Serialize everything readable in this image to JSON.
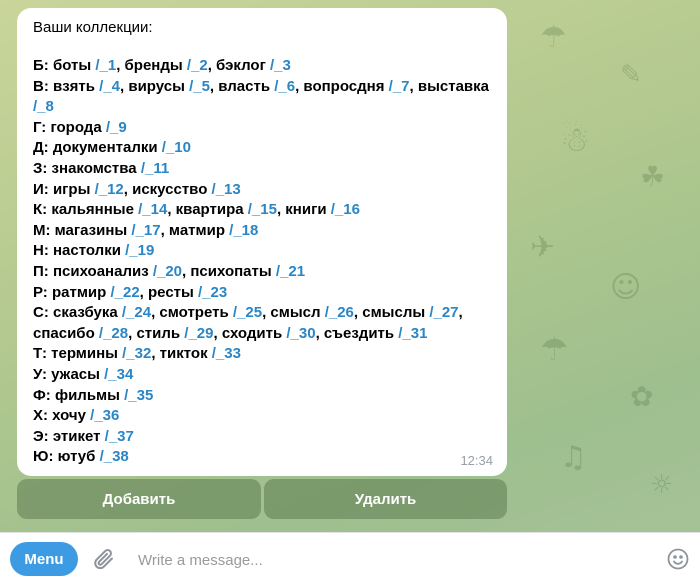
{
  "message": {
    "title": "Ваши коллекции:",
    "time": "12:34",
    "lines": [
      [
        {
          "t": "Б: боты "
        },
        {
          "c": "/_1"
        },
        {
          "t": ", бренды "
        },
        {
          "c": "/_2"
        },
        {
          "t": ", бэклог "
        },
        {
          "c": "/_3"
        }
      ],
      [
        {
          "t": "В: взять "
        },
        {
          "c": "/_4"
        },
        {
          "t": ", вирусы "
        },
        {
          "c": "/_5"
        },
        {
          "t": ", власть "
        },
        {
          "c": "/_6"
        },
        {
          "t": ", вопросдня "
        },
        {
          "c": "/_7"
        },
        {
          "t": ", выставка "
        },
        {
          "c": "/_8"
        }
      ],
      [
        {
          "t": "Г: города "
        },
        {
          "c": "/_9"
        }
      ],
      [
        {
          "t": "Д: документалки "
        },
        {
          "c": "/_10"
        }
      ],
      [
        {
          "t": "З: знакомства "
        },
        {
          "c": "/_11"
        }
      ],
      [
        {
          "t": "И: игры "
        },
        {
          "c": "/_12"
        },
        {
          "t": ", искусство "
        },
        {
          "c": "/_13"
        }
      ],
      [
        {
          "t": "К: кальянные "
        },
        {
          "c": "/_14"
        },
        {
          "t": ", квартира "
        },
        {
          "c": "/_15"
        },
        {
          "t": ", книги "
        },
        {
          "c": "/_16"
        }
      ],
      [
        {
          "t": "М: магазины "
        },
        {
          "c": "/_17"
        },
        {
          "t": ", матмир "
        },
        {
          "c": "/_18"
        }
      ],
      [
        {
          "t": "Н: настолки "
        },
        {
          "c": "/_19"
        }
      ],
      [
        {
          "t": "П: психоанализ "
        },
        {
          "c": "/_20"
        },
        {
          "t": ", психопаты "
        },
        {
          "c": "/_21"
        }
      ],
      [
        {
          "t": "Р: ратмир "
        },
        {
          "c": "/_22"
        },
        {
          "t": ", ресты "
        },
        {
          "c": "/_23"
        }
      ],
      [
        {
          "t": "С: сказбука "
        },
        {
          "c": "/_24"
        },
        {
          "t": ", смотреть "
        },
        {
          "c": "/_25"
        },
        {
          "t": ", смысл "
        },
        {
          "c": "/_26"
        },
        {
          "t": ", смыслы "
        },
        {
          "c": "/_27"
        },
        {
          "t": ", спасибо "
        },
        {
          "c": "/_28"
        },
        {
          "t": ", стиль "
        },
        {
          "c": "/_29"
        },
        {
          "t": ", сходить "
        },
        {
          "c": "/_30"
        },
        {
          "t": ", съездить "
        },
        {
          "c": "/_31"
        }
      ],
      [
        {
          "t": "Т: термины "
        },
        {
          "c": "/_32"
        },
        {
          "t": ", тикток "
        },
        {
          "c": "/_33"
        }
      ],
      [
        {
          "t": "У: ужасы "
        },
        {
          "c": "/_34"
        }
      ],
      [
        {
          "t": "Ф: фильмы "
        },
        {
          "c": "/_35"
        }
      ],
      [
        {
          "t": "Х: хочу "
        },
        {
          "c": "/_36"
        }
      ],
      [
        {
          "t": "Э: этикет "
        },
        {
          "c": "/_37"
        }
      ],
      [
        {
          "t": "Ю: ютуб "
        },
        {
          "c": "/_38"
        }
      ]
    ]
  },
  "keyboard": {
    "add_label": "Добавить",
    "delete_label": "Удалить"
  },
  "composer": {
    "menu_label": "Menu",
    "placeholder": "Write a message...",
    "attach_icon": "paperclip-icon",
    "emoji_icon": "smile-icon"
  },
  "colors": {
    "command_link": "#2a86c6",
    "menu_button": "#3d9be4",
    "keyboard_button": "#7e9c6c"
  }
}
